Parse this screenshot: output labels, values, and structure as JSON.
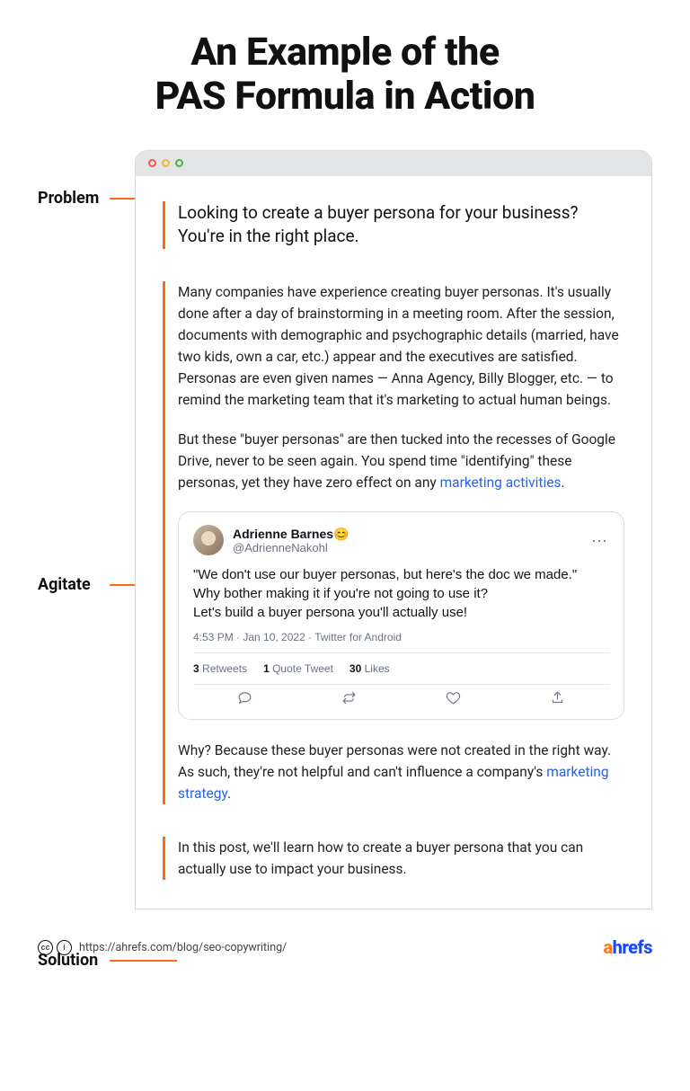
{
  "title_line1": "An Example of the",
  "title_line2": "PAS Formula in Action",
  "labels": {
    "problem": "Problem",
    "agitate": "Agitate",
    "solution": "Solution"
  },
  "problem": {
    "text": "Looking to create a buyer persona for your business? You're in the right place."
  },
  "agitate": {
    "para1": "Many companies have experience creating buyer personas. It's usually done after a day of brainstorming in a meeting room. After the session, documents with demographic and psychographic details (married, have two kids, own a car, etc.) appear and the executives are satisfied. Personas are even given names — Anna Agency, Billy Blogger, etc. — to remind the marketing team that it's marketing to actual human beings.",
    "para2_before_link": "But these \"buyer personas\" are then tucked into the recesses of Google Drive, never to be seen again. You spend time \"identifying\" these personas, yet they have zero effect on any ",
    "para2_link": "marketing activities",
    "para2_after_link": ".",
    "tweet": {
      "name": "Adrienne Barnes",
      "emoji": "😊",
      "handle": "@AdrienneNakohl",
      "line1": "\"We don't use our buyer personas, but here's the doc we made.\"",
      "line2": "Why bother making it if you're not going to use it?",
      "line3": "Let's build a buyer persona you'll actually use!",
      "meta": "4:53 PM · Jan 10, 2022 · Twitter for Android",
      "retweets_n": "3",
      "retweets_l": "Retweets",
      "quotes_n": "1",
      "quotes_l": "Quote Tweet",
      "likes_n": "30",
      "likes_l": "Likes"
    },
    "para3_before_link": "Why? Because these buyer personas were not created in the right way. As such, they're not helpful and can't influence a company's ",
    "para3_link": "marketing strategy",
    "para3_after_link": "."
  },
  "solution": {
    "text": "In this post, we'll learn how to create a buyer persona that you can actually use to impact your business."
  },
  "footer": {
    "cc1": "cc",
    "cc2": "i",
    "url": "https://ahrefs.com/blog/seo-copywriting/",
    "logo_a": "a",
    "logo_rest": "hrefs"
  }
}
